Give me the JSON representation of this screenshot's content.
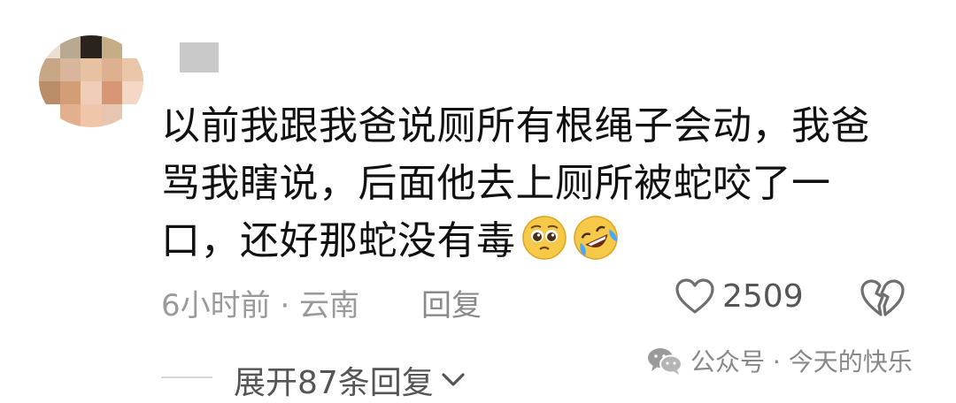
{
  "comment": {
    "text": "以前我跟我爸说厕所有根绳子会动，我爸骂我瞎说，后面他去上厕所被蛇咬了一口，还好那蛇没有毒"
  },
  "meta": {
    "time_location": "6小时前 · 云南",
    "reply_label": "回复"
  },
  "actions": {
    "like_count": "2509",
    "like_icon": "heart-outline-icon",
    "dislike_icon": "broken-heart-icon"
  },
  "replies": {
    "expand_label": "展开87条回复"
  },
  "watermark": {
    "text": "公众号 · 今天的快乐"
  },
  "emojis": [
    "pleading-face-icon",
    "rolling-laughing-icon"
  ]
}
